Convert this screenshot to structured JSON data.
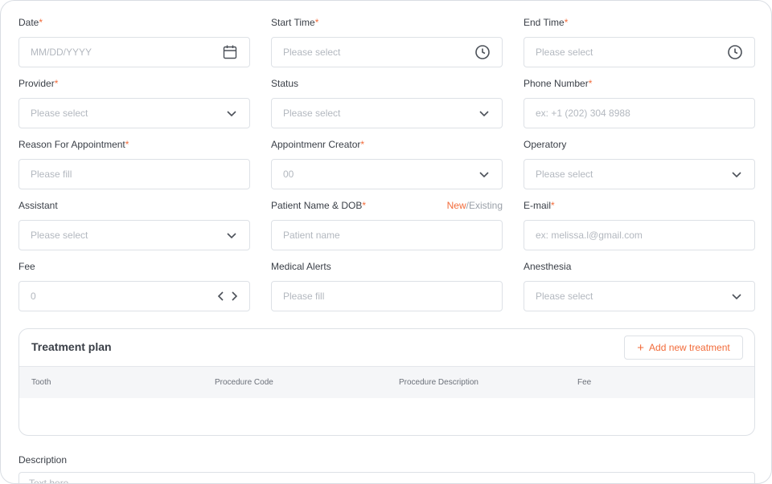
{
  "form": {
    "date": {
      "label": "Date",
      "required_mark": "*",
      "placeholder": "MM/DD/YYYY",
      "icon": "calendar-icon"
    },
    "start_time": {
      "label": "Start Time",
      "required_mark": "*",
      "placeholder": "Please select",
      "icon": "clock-icon"
    },
    "end_time": {
      "label": "End Time",
      "required_mark": "*",
      "placeholder": "Please select",
      "icon": "clock-icon"
    },
    "provider": {
      "label": "Provider",
      "required_mark": "*",
      "placeholder": "Please select",
      "icon": "chevron-down-icon"
    },
    "status": {
      "label": "Status",
      "placeholder": "Please select",
      "icon": "chevron-down-icon"
    },
    "phone": {
      "label": "Phone Number",
      "required_mark": "*",
      "placeholder": "ex: +1 (202) 304 8988"
    },
    "reason": {
      "label": "Reason For Appointment",
      "required_mark": "*",
      "placeholder": "Please fill"
    },
    "creator": {
      "label": "Appointmenr Creator",
      "required_mark": "*",
      "value": "00",
      "icon": "chevron-down-icon"
    },
    "operatory": {
      "label": "Operatory",
      "placeholder": "Please select",
      "icon": "chevron-down-icon"
    },
    "assistant": {
      "label": "Assistant",
      "placeholder": "Please select",
      "icon": "chevron-down-icon"
    },
    "patient": {
      "label": "Patient Name & DOB",
      "required_mark": "*",
      "toggle_new": "New",
      "toggle_existing": "/Existing",
      "placeholder": "Patient name"
    },
    "email": {
      "label": "E-mail",
      "required_mark": "*",
      "placeholder": "ex: melissa.l@gmail.com"
    },
    "fee": {
      "label": "Fee",
      "value": "0",
      "icon": "code-brackets-icon"
    },
    "medical_alerts": {
      "label": "Medical Alerts",
      "placeholder": "Please fill"
    },
    "anesthesia": {
      "label": "Anesthesia",
      "placeholder": "Please select",
      "icon": "chevron-down-icon"
    }
  },
  "treatment_plan": {
    "title": "Treatment plan",
    "add_button": "Add new treatment",
    "add_icon": "plus-icon",
    "columns": [
      "Tooth",
      "Procedure Code",
      "Procedure Description",
      "Fee"
    ]
  },
  "description": {
    "label": "Description",
    "placeholder": "Text here"
  },
  "colors": {
    "accent": "#f26b3a",
    "border": "#dde1e6",
    "placeholder": "#b3b8bf"
  }
}
